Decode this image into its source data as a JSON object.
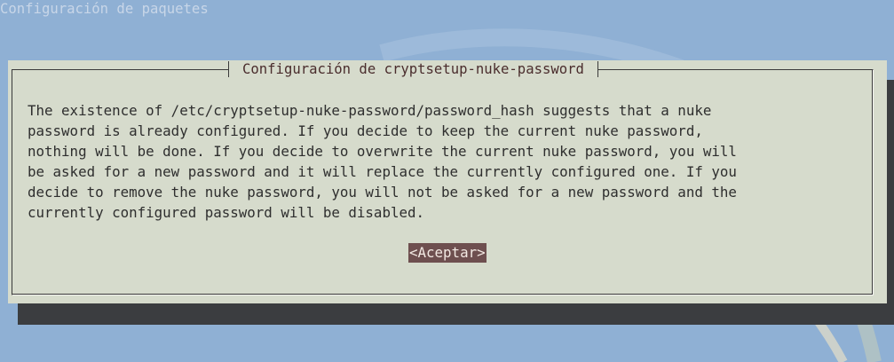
{
  "backtitle": "Configuración de paquetes",
  "dialog": {
    "title": "Configuración de cryptsetup-nuke-password",
    "message_lines": [
      "The existence of /etc/cryptsetup-nuke-password/password_hash suggests that a nuke",
      "password is already configured. If you decide to keep the current nuke password,",
      "nothing will be done. If you decide to overwrite the current nuke password, you will",
      "be asked for a new password and it will replace the currently configured one. If you",
      "decide to remove the nuke password, you will not be asked for a new password and the",
      "currently configured password will be disabled."
    ],
    "ok_button_label": "<Aceptar>"
  },
  "colors": {
    "desktop_background": "#8fb0d4",
    "dialog_background": "#d6dbcc",
    "dialog_shadow": "#3b3d40",
    "button_background": "#6e4f4f",
    "button_text": "#f3e9e3",
    "title_text": "#4a2d2d"
  }
}
